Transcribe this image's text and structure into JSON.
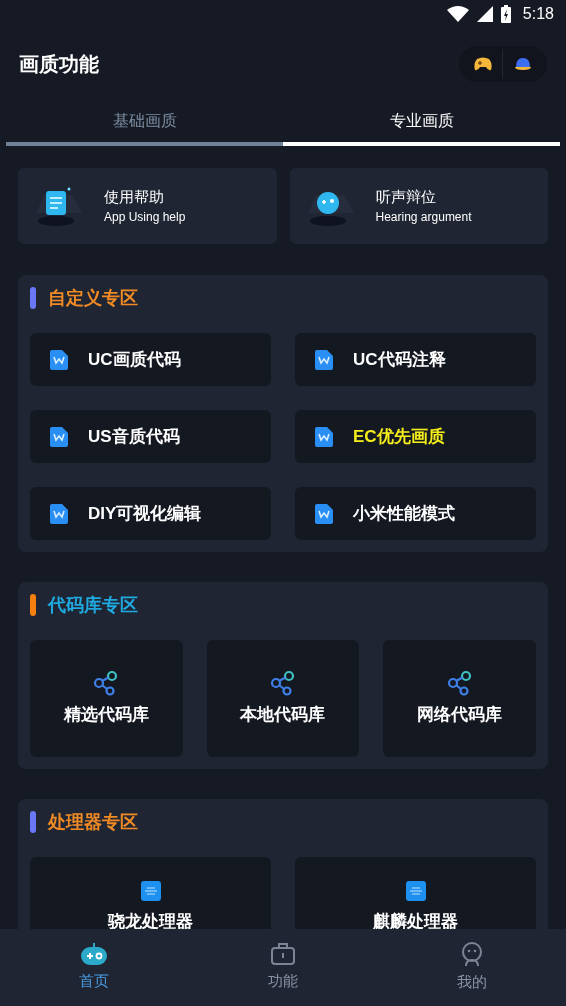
{
  "status_bar": {
    "time": "5:18"
  },
  "header": {
    "title": "画质功能"
  },
  "tabs": [
    {
      "label": "基础画质",
      "selected": false
    },
    {
      "label": "专业画质",
      "selected": true
    }
  ],
  "help_cards": [
    {
      "kind": "document",
      "title": "使用帮助",
      "subtitle": "App Using help"
    },
    {
      "kind": "sound",
      "title": "听声辩位",
      "subtitle": "Hearing argument"
    }
  ],
  "sections": [
    {
      "title": "自定义专区",
      "color": "#6b78f6",
      "kind": "list",
      "items": [
        {
          "label": "UC画质代码",
          "highlighted": false
        },
        {
          "label": "UC代码注释",
          "highlighted": false
        },
        {
          "label": "US音质代码",
          "highlighted": false
        },
        {
          "label": "EC优先画质",
          "highlighted": true
        },
        {
          "label": "DIY可视化编辑",
          "highlighted": false
        },
        {
          "label": "小米性能模式",
          "highlighted": false
        }
      ]
    },
    {
      "title": "代码库专区",
      "color": "#f5800f",
      "kind": "library",
      "items": [
        {
          "label": "精选代码库",
          "highlighted": false
        },
        {
          "label": "本地代码库",
          "highlighted": false
        },
        {
          "label": "网络代码库",
          "highlighted": false
        }
      ]
    },
    {
      "title": "处理器专区",
      "color": "#6b78f6",
      "kind": "processor",
      "items": [
        {
          "label": "骁龙处理器",
          "highlighted": false
        },
        {
          "label": "麒麟处理器",
          "highlighted": false
        }
      ]
    }
  ],
  "bottom_nav": [
    {
      "label": "首页",
      "kind": "home",
      "selected": true
    },
    {
      "label": "功能",
      "kind": "toolbox",
      "selected": false
    },
    {
      "label": "我的",
      "kind": "profile",
      "selected": false
    }
  ]
}
